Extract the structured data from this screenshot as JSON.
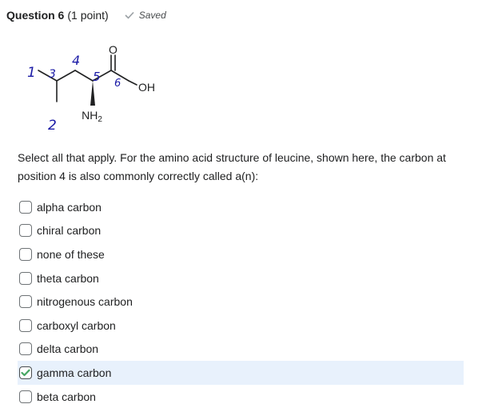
{
  "question": {
    "title": "Question 6",
    "points": "(1 point)",
    "saved_label": "Saved"
  },
  "structure": {
    "oxygen_label": "O",
    "hydroxyl_label": "OH",
    "amine_label": "NH",
    "amine_subscript": "2",
    "carbon_numbers": [
      "1",
      "2",
      "3",
      "4",
      "5",
      "6"
    ]
  },
  "prompt": "Select all that apply. For the amino acid structure of leucine, shown here, the carbon at position 4 is also commonly correctly called a(n):",
  "options": [
    {
      "label": "alpha carbon",
      "checked": false
    },
    {
      "label": "chiral carbon",
      "checked": false
    },
    {
      "label": "none of these",
      "checked": false
    },
    {
      "label": "theta carbon",
      "checked": false
    },
    {
      "label": "nitrogenous carbon",
      "checked": false
    },
    {
      "label": "carboxyl carbon",
      "checked": false
    },
    {
      "label": "delta carbon",
      "checked": false
    },
    {
      "label": "gamma carbon",
      "checked": true
    },
    {
      "label": "beta carbon",
      "checked": false
    }
  ],
  "colors": {
    "handwriting": "#1a1aa6",
    "selected_bg": "#e8f1fc",
    "check_green": "#46a661"
  }
}
